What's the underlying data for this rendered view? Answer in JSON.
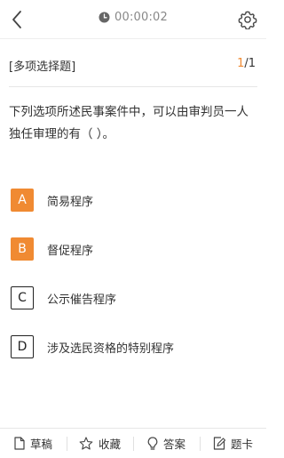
{
  "header": {
    "timer": "00:00:02",
    "icons": {
      "back": "chevron-left-icon",
      "clock": "clock-icon",
      "settings": "gear-icon"
    }
  },
  "question": {
    "type_label": "[多项选择题]",
    "current": "1",
    "total": "/1",
    "stem": "下列选项所述民事案件中，可以由审判员一人独任审理的有（ ）。",
    "options": [
      {
        "letter": "A",
        "text": "简易程序",
        "selected": true
      },
      {
        "letter": "B",
        "text": "督促程序",
        "selected": true
      },
      {
        "letter": "C",
        "text": "公示催告程序",
        "selected": false
      },
      {
        "letter": "D",
        "text": "涉及选民资格的特别程序",
        "selected": false
      }
    ]
  },
  "bottom_tabs": [
    {
      "label": "草稿",
      "icon": "draft-icon"
    },
    {
      "label": "收藏",
      "icon": "star-icon"
    },
    {
      "label": "答案",
      "icon": "lightbulb-icon"
    },
    {
      "label": "题卡",
      "icon": "answer-card-icon"
    }
  ],
  "colors": {
    "accent": "#f08a32",
    "text": "#333333",
    "muted": "#888888"
  }
}
